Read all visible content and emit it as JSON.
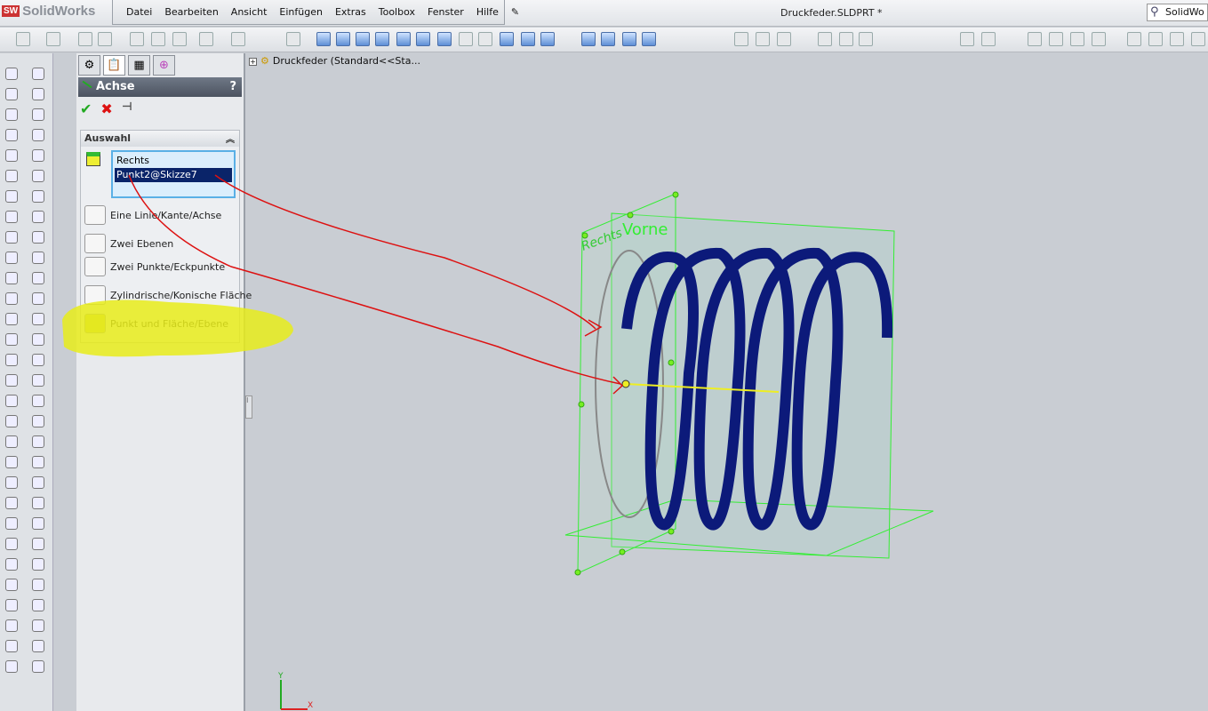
{
  "app": {
    "name": "SolidWorks",
    "document_title": "Druckfeder.SLDPRT *",
    "search_placeholder": "SolidWo"
  },
  "menu": [
    "Datei",
    "Bearbeiten",
    "Ansicht",
    "Einfügen",
    "Extras",
    "Toolbox",
    "Fenster",
    "Hilfe"
  ],
  "property_manager": {
    "title": "Achse",
    "help": "?",
    "group_title": "Auswahl",
    "selections": [
      "Rechts",
      "Punkt2@Skizze7"
    ],
    "options": [
      "Eine Linie/Kante/Achse",
      "Zwei Ebenen",
      "Zwei Punkte/Eckpunkte",
      "Zylindrische/Konische Fläche",
      "Punkt und Fläche/Ebene"
    ]
  },
  "tree": {
    "root": "Druckfeder  (Standard<<Sta..."
  },
  "viewport": {
    "plane_labels": [
      "Rechts",
      "Vorne"
    ],
    "spring_color": "#0c1a7a",
    "highlight_color": "#e8ec1a",
    "annotation_color": "#dd1111"
  }
}
